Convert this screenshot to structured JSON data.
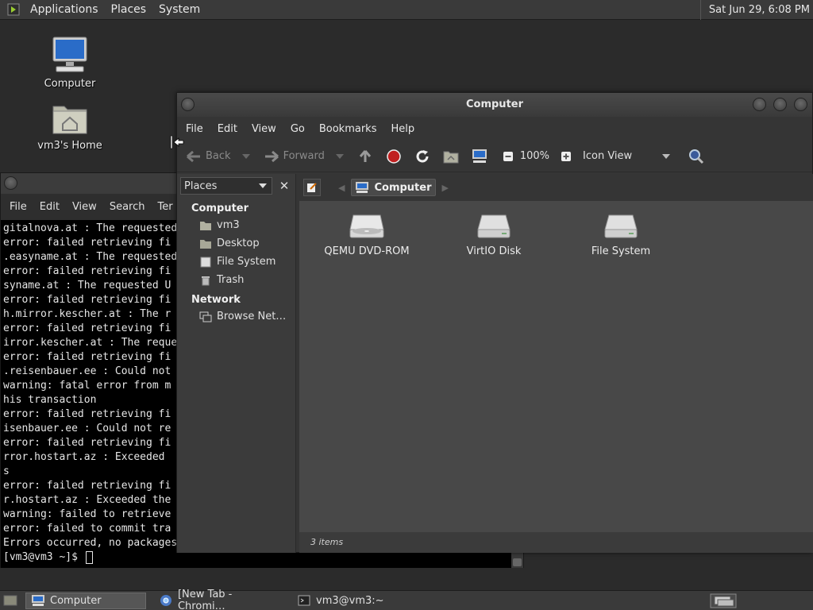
{
  "top_panel": {
    "menus": [
      "Applications",
      "Places",
      "System"
    ],
    "clock": "Sat Jun 29,  6:08 PM"
  },
  "desktop": {
    "icons": [
      {
        "label": "Computer",
        "icon": "computer-icon"
      },
      {
        "label": "vm3's Home",
        "icon": "home-folder-icon"
      }
    ]
  },
  "terminal": {
    "menus": [
      "File",
      "Edit",
      "View",
      "Search",
      "Ter"
    ],
    "lines": [
      "gitalnova.at : The requested",
      "error: failed retrieving fi",
      ".easyname.at : The requested",
      "error: failed retrieving fi",
      "syname.at : The requested U",
      "error: failed retrieving fi",
      "h.mirror.kescher.at : The r",
      "error: failed retrieving fi",
      "irror.kescher.at : The reque",
      "error: failed retrieving fi",
      ".reisenbauer.ee : Could not",
      "warning: fatal error from m",
      "his transaction",
      "error: failed retrieving fi",
      "isenbauer.ee : Could not re",
      "error: failed retrieving fi",
      "rror.hostart.az : Exceeded",
      "s",
      "error: failed retrieving fi",
      "r.hostart.az : Exceeded the",
      "warning: failed to retrieve",
      "error: failed to commit tra",
      "Errors occurred, no packages"
    ],
    "prompt": "[vm3@vm3 ~]$ "
  },
  "file_manager": {
    "title": "Computer",
    "menus": [
      "File",
      "Edit",
      "View",
      "Go",
      "Bookmarks",
      "Help"
    ],
    "toolbar": {
      "back": "Back",
      "forward": "Forward",
      "zoom": "100%",
      "view_mode": "Icon View"
    },
    "sidebar": {
      "selector": "Places",
      "sections": [
        {
          "heading": "Computer",
          "items": [
            {
              "label": "vm3",
              "icon": "home-icon"
            },
            {
              "label": "Desktop",
              "icon": "desktop-folder-icon"
            },
            {
              "label": "File System",
              "icon": "filesystem-icon"
            },
            {
              "label": "Trash",
              "icon": "trash-icon"
            }
          ]
        },
        {
          "heading": "Network",
          "items": [
            {
              "label": "Browse Net…",
              "icon": "network-icon"
            }
          ]
        }
      ]
    },
    "location": {
      "crumb": "Computer"
    },
    "items": [
      {
        "label": "QEMU DVD-ROM",
        "icon": "optical-drive-icon"
      },
      {
        "label": "VirtIO Disk",
        "icon": "hard-disk-icon"
      },
      {
        "label": "File System",
        "icon": "hard-disk-icon"
      }
    ],
    "status": "3 items"
  },
  "taskbar": {
    "tasks": [
      {
        "label": "Computer",
        "icon": "computer-icon",
        "active": true
      },
      {
        "label": "[New Tab - Chromi…",
        "icon": "chromium-icon",
        "active": false
      },
      {
        "label": "vm3@vm3:~",
        "icon": "terminal-icon",
        "active": false
      }
    ]
  },
  "colors": {
    "panel": "#3a3a3a",
    "desktop": "#2b2b2b",
    "content": "#484848",
    "stop_red": "#c02020"
  }
}
